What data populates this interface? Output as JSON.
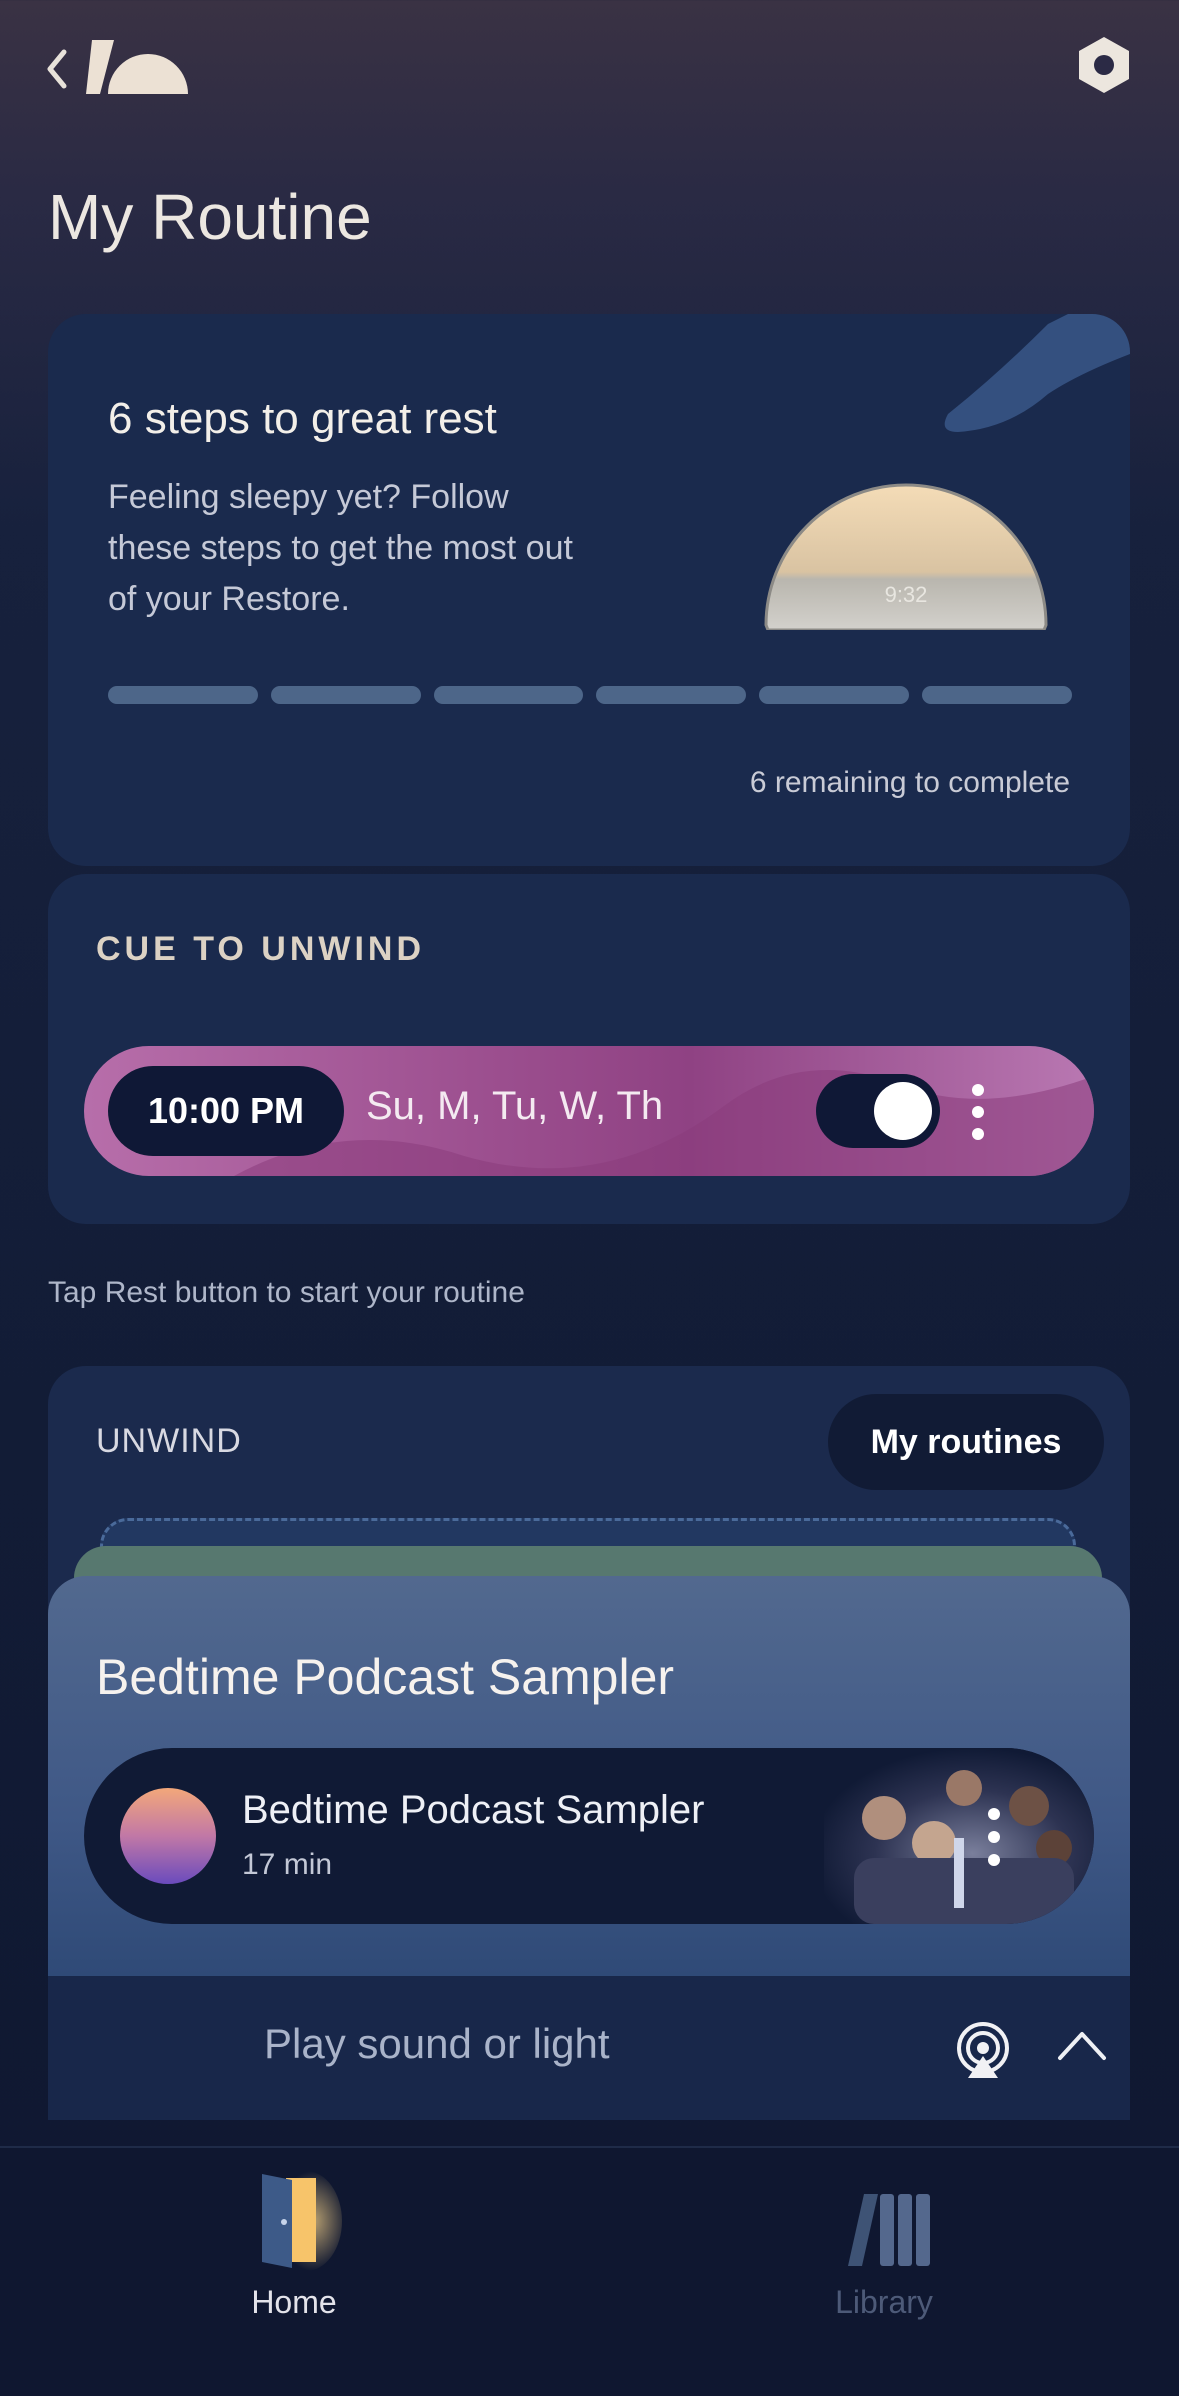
{
  "header": {
    "title": "My Routine",
    "back_icon": "chevron-left-icon",
    "logo": "hatch-logo",
    "settings_icon": "hexagon-settings-icon"
  },
  "steps_card": {
    "title": "6 steps to great rest",
    "description": "Feeling sleepy yet? Follow these steps to get the most out of your Restore.",
    "device_clock": "9:32",
    "progress": {
      "completed": 0,
      "total": 6
    },
    "remaining_text": "6 remaining to complete"
  },
  "cue_card": {
    "label": "CUE TO UNWIND",
    "time": "10:00 PM",
    "days": "Su, M, Tu, W, Th",
    "toggle_on": true
  },
  "hint": "Tap Rest button to start your routine",
  "unwind": {
    "label": "UNWIND",
    "routines_button": "My routines",
    "card_title": "Bedtime Podcast Sampler",
    "item": {
      "name": "Bedtime Podcast Sampler",
      "duration": "17 min"
    }
  },
  "player": {
    "label": "Play sound or light",
    "cast_icon": "airplay-icon",
    "expand_icon": "chevron-up-icon"
  },
  "tabs": [
    {
      "label": "Home",
      "icon": "door-icon",
      "active": true
    },
    {
      "label": "Library",
      "icon": "library-books-icon",
      "active": false
    }
  ],
  "colors": {
    "card": "#1a2a4d",
    "cue_pill": "#9c4f8f",
    "progress_track": "#4d6689",
    "accent_text": "#dcd2c4"
  }
}
